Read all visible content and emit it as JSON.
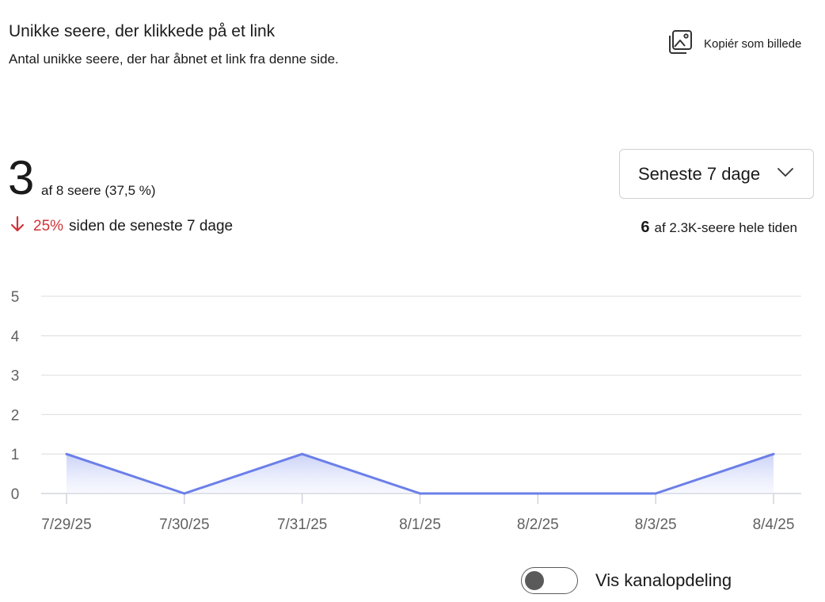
{
  "header": {
    "title": "Unikke seere, der klikkede på et link",
    "subtitle": "Antal unikke seere, der har åbnet et link fra denne side.",
    "copy_label": "Kopiér som billede"
  },
  "summary": {
    "count": "3",
    "of_viewers": "af 8 seere (37,5 %)",
    "change_pct": "25%",
    "change_label": "siden de seneste 7 dage",
    "change_color": "#d13438"
  },
  "range": {
    "selected": "Seneste 7 dage"
  },
  "alltime": {
    "count": "6",
    "label": "af 2.3K-seere hele tiden"
  },
  "toggle": {
    "label": "Vis kanalopdeling",
    "on": false
  },
  "chart_data": {
    "type": "area",
    "categories": [
      "7/29/25",
      "7/30/25",
      "7/31/25",
      "8/1/25",
      "8/2/25",
      "8/3/25",
      "8/4/25"
    ],
    "series": [
      {
        "values": [
          1,
          0,
          1,
          0,
          0,
          0,
          1
        ]
      }
    ],
    "ylim": [
      0,
      5
    ],
    "yticks": [
      0,
      1,
      2,
      3,
      4,
      5
    ],
    "grid": true,
    "line_color": "#6b7fe8"
  }
}
